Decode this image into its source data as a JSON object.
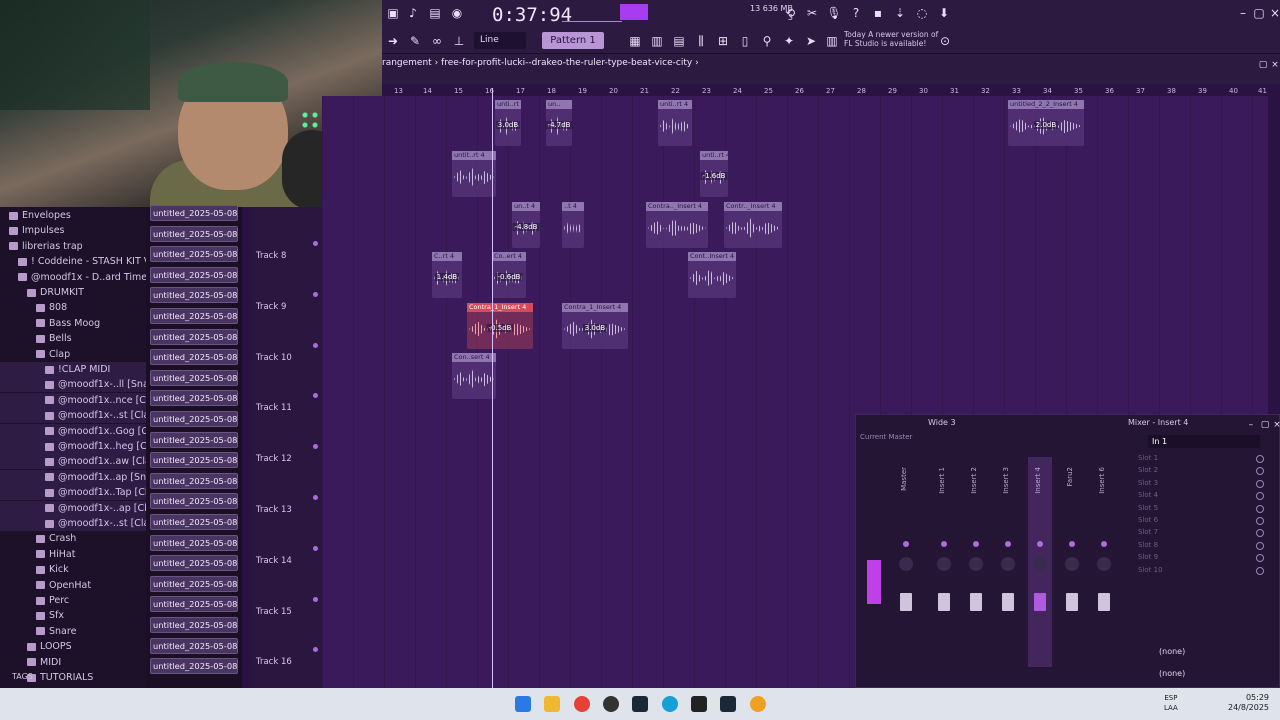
{
  "toolbar": {
    "time": "0:37:94",
    "cpu_line1": "13   636 MB",
    "cpu_line2": "3",
    "snap_label": "Line",
    "pattern_label": "Pattern 1",
    "news_line1": "Today  A newer version of",
    "news_line2": "FL Studio is available!"
  },
  "arrangement": {
    "breadcrumb": "rangement  ›  free-for-profit-lucki--drakeo-the-ruler-type-beat-vice-city  ›",
    "ruler": [
      "13",
      "14",
      "15",
      "16",
      "17",
      "18",
      "19",
      "20",
      "21",
      "22",
      "23",
      "24",
      "25",
      "26",
      "27",
      "28",
      "29",
      "30",
      "31",
      "32",
      "33",
      "34",
      "35",
      "36",
      "37",
      "38",
      "39",
      "40",
      "41"
    ]
  },
  "browser": {
    "items": [
      {
        "label": "Envelopes",
        "indent": 1,
        "sel": false
      },
      {
        "label": "Impulses",
        "indent": 1,
        "sel": false
      },
      {
        "label": "librerias trap",
        "indent": 1,
        "sel": false
      },
      {
        "label": "! Coddeine - STASH KIT V3 !",
        "indent": 2,
        "sel": false
      },
      {
        "label": "@moodf1x - D..ard Times_",
        "indent": 2,
        "sel": false
      },
      {
        "label": "DRUMKIT",
        "indent": 3,
        "sel": false
      },
      {
        "label": "808",
        "indent": 4,
        "sel": false
      },
      {
        "label": "Bass Moog",
        "indent": 4,
        "sel": false
      },
      {
        "label": "Bells",
        "indent": 4,
        "sel": false
      },
      {
        "label": "Clap",
        "indent": 4,
        "sel": false
      },
      {
        "label": "!CLAP MIDI",
        "indent": 5,
        "sel": true
      },
      {
        "label": "@moodf1x-..ll [Snap]",
        "indent": 5,
        "sel": true
      },
      {
        "label": "@moodf1x..nce [Clap]",
        "indent": 5,
        "sel": true
      },
      {
        "label": "@moodf1x-..st [Clap]",
        "indent": 5,
        "sel": true
      },
      {
        "label": "@moodf1x..Gog [Clap]",
        "indent": 5,
        "sel": true
      },
      {
        "label": "@moodf1x..heg [Clap]",
        "indent": 5,
        "sel": true
      },
      {
        "label": "@moodf1x..aw [Clap]",
        "indent": 5,
        "sel": true
      },
      {
        "label": "@moodf1x..ap [Snap]",
        "indent": 5,
        "sel": true
      },
      {
        "label": "@moodf1x..Tap [Clap]",
        "indent": 5,
        "sel": true
      },
      {
        "label": "@moodf1x-..ap [Clap]",
        "indent": 5,
        "sel": true
      },
      {
        "label": "@moodf1x-..st [Clap]",
        "indent": 5,
        "sel": true
      },
      {
        "label": "Crash",
        "indent": 4,
        "sel": false
      },
      {
        "label": "HiHat",
        "indent": 4,
        "sel": false
      },
      {
        "label": "Kick",
        "indent": 4,
        "sel": false
      },
      {
        "label": "OpenHat",
        "indent": 4,
        "sel": false
      },
      {
        "label": "Perc",
        "indent": 4,
        "sel": false
      },
      {
        "label": "Sfx",
        "indent": 4,
        "sel": false
      },
      {
        "label": "Snare",
        "indent": 4,
        "sel": false
      },
      {
        "label": "LOOPS",
        "indent": 3,
        "sel": false
      },
      {
        "label": "MIDI",
        "indent": 3,
        "sel": false
      },
      {
        "label": "TUTORIALS",
        "indent": 3,
        "sel": false
      }
    ],
    "tags_label": "TAGS"
  },
  "clip_source": {
    "label": "untitled_2025-05-08 01-",
    "count": 23
  },
  "tracks": [
    "Track 8",
    "Track 9",
    "Track 10",
    "Track 11",
    "Track 12",
    "Track 13",
    "Track 14",
    "Track 15",
    "Track 16"
  ],
  "clips": [
    {
      "name": "unti..rt 4",
      "db": "3.0dB"
    },
    {
      "name": "un..",
      "db": "-4.7dB"
    },
    {
      "name": "unti..rt 4",
      "db": ""
    },
    {
      "name": "untitled_2_2_Insert 4",
      "db": "2.0dB"
    },
    {
      "name": "untit..rt 4",
      "db": ""
    },
    {
      "name": "unti..rt 4",
      "db": "-1.6dB"
    },
    {
      "name": "un..t 4",
      "db": "-4.8dB"
    },
    {
      "name": "..t 4",
      "db": ""
    },
    {
      "name": "Contra.._Insert 4",
      "db": ""
    },
    {
      "name": "Contr.._Insert 4",
      "db": ""
    },
    {
      "name": "C..rt 4",
      "db": "1.4dB"
    },
    {
      "name": "Co..ert 4",
      "db": "-0.6dB"
    },
    {
      "name": "Cont..Insert 4",
      "db": ""
    },
    {
      "name": "Contra_1_Insert 4",
      "db": "-0.5dB"
    },
    {
      "name": "Contra_1_Insert 4",
      "db": "3.0dB"
    },
    {
      "name": "Con..sert 4",
      "db": ""
    }
  ],
  "mixer": {
    "preset": "Wide 3",
    "title": "Mixer - Insert 4",
    "tabs": "Current   Master",
    "input": "In 1",
    "strips": [
      "Master",
      "Insert 1",
      "Insert 2",
      "Insert 3",
      "Insert 4",
      "Faru2",
      "Insert 6"
    ],
    "slots": [
      "Slot 1",
      "Slot 2",
      "Slot 3",
      "Slot 4",
      "Slot 5",
      "Slot 6",
      "Slot 7",
      "Slot 8",
      "Slot 9",
      "Slot 10"
    ],
    "none_1": "(none)",
    "none_2": "(none)"
  },
  "taskbar": {
    "lang_line1": "ESP",
    "lang_line2": "LAA",
    "clock_time": "05:29",
    "clock_date": "24/8/2025"
  }
}
